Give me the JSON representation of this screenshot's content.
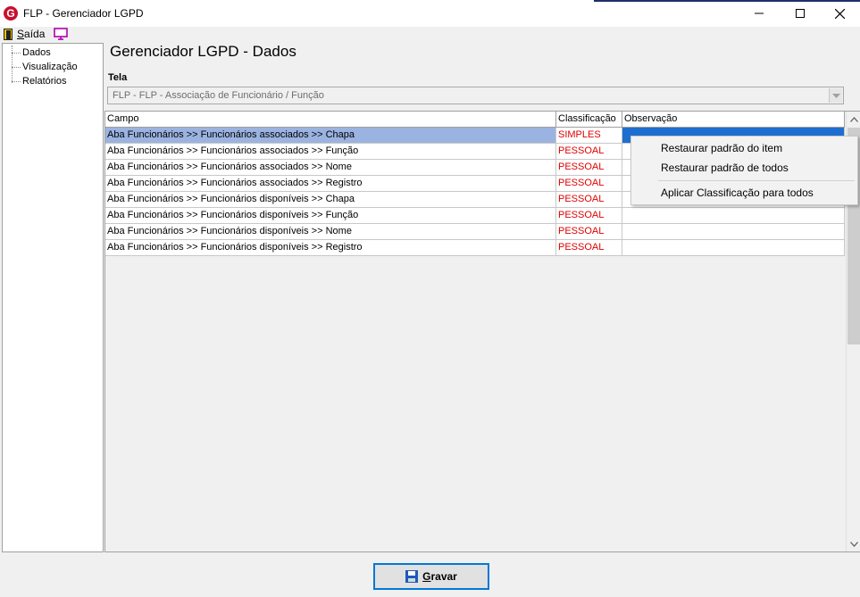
{
  "window": {
    "title": "FLP - Gerenciador LGPD",
    "app_icon_letter": "G"
  },
  "menu": {
    "exit_label_underlined": "S",
    "exit_label_rest": "aída"
  },
  "tree": {
    "items": [
      {
        "label": "Dados"
      },
      {
        "label": "Visualização"
      },
      {
        "label": "Relatórios"
      }
    ]
  },
  "main": {
    "title": "Gerenciador LGPD - Dados",
    "tela_label": "Tela",
    "tela_value": "FLP - FLP - Associação de Funcionário / Função"
  },
  "grid": {
    "columns": [
      "Campo",
      "Classificação",
      "Observação"
    ],
    "rows": [
      {
        "campo": "Aba Funcionários >> Funcionários associados >> Chapa",
        "classificacao": "SIMPLES",
        "observacao": "",
        "selected": true
      },
      {
        "campo": "Aba Funcionários >> Funcionários associados >> Função",
        "classificacao": "PESSOAL",
        "observacao": ""
      },
      {
        "campo": "Aba Funcionários >> Funcionários associados >> Nome",
        "classificacao": "PESSOAL",
        "observacao": ""
      },
      {
        "campo": "Aba Funcionários >> Funcionários associados >> Registro",
        "classificacao": "PESSOAL",
        "observacao": ""
      },
      {
        "campo": "Aba Funcionários >> Funcionários disponíveis >> Chapa",
        "classificacao": "PESSOAL",
        "observacao": ""
      },
      {
        "campo": "Aba Funcionários >> Funcionários disponíveis >> Função",
        "classificacao": "PESSOAL",
        "observacao": ""
      },
      {
        "campo": "Aba Funcionários >> Funcionários disponíveis >> Nome",
        "classificacao": "PESSOAL",
        "observacao": ""
      },
      {
        "campo": "Aba Funcionários >> Funcionários disponíveis >> Registro",
        "classificacao": "PESSOAL",
        "observacao": ""
      }
    ]
  },
  "context_menu": {
    "items": [
      "Restaurar padrão do item",
      "Restaurar padrão de todos",
      "Aplicar Classificação para todos"
    ]
  },
  "footer": {
    "save_underlined": "G",
    "save_rest": "ravar"
  },
  "colors": {
    "classification_text": "#e00000",
    "selected_row": "#9bb3e0",
    "selected_cell": "#1e6ecf",
    "focus_border": "#0078d7"
  }
}
